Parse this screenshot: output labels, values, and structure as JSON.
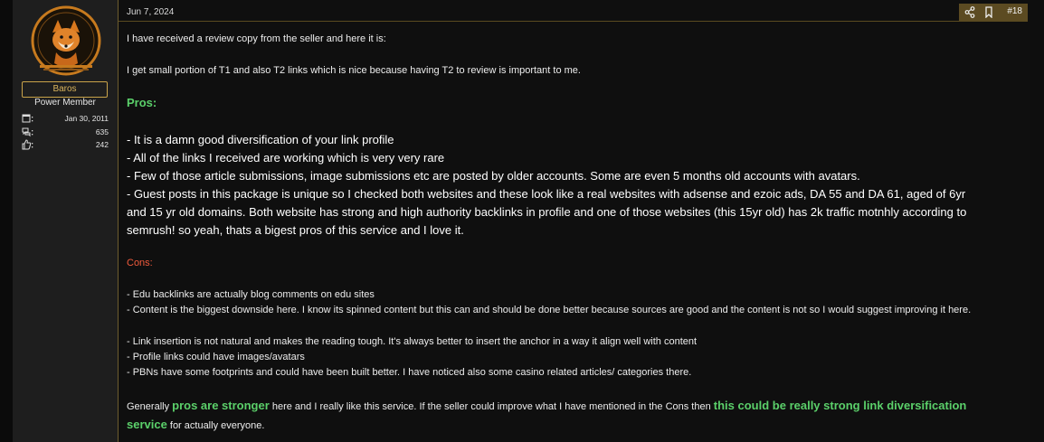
{
  "user": {
    "name": "Baros",
    "title": "Power Member",
    "joined": "Jan 30, 2011",
    "messages": "635",
    "reactions": "242"
  },
  "post": {
    "date": "Jun 7, 2024",
    "number": "#18",
    "p1": "I have received a review copy from the seller and here it is:",
    "p2": "I get small portion of T1 and also T2 links which is nice because having T2 to review is important to me.",
    "pros_heading": "Pros:",
    "pros": [
      "- It is a damn good diversification of your link profile",
      "- All of the links I received are working which is very very rare",
      "- Few of those article submissions, image submissions etc are posted by older accounts. Some are even 5 months old accounts with avatars.",
      "- Guest posts in this package is unique so I checked both websites and these look like a real websites with adsense and ezoic ads, DA 55 and DA 61, aged of 6yr and 15 yr old domains. Both website has strong and high authority backlinks in profile and one of those websites (this 15yr old) has 2k traffic motnhly according to semrush! so yeah, thats a bigest pros of this service and I love it."
    ],
    "cons_heading": "Cons:",
    "cons": [
      "- Edu backlinks are actually blog comments on edu sites",
      "- Content is the biggest downside here. I know its spinned content but this can and should be done better because sources are good and the content is not so I would suggest improving it here.",
      "- Link insertion is not natural and makes the reading tough. It's always better to insert the anchor in a way it align well with content",
      "- Profile links could have images/avatars",
      "- PBNs have some footprints and could have been built better. I have noticed also some casino related articles/ categories there."
    ],
    "summary_a": "Generally ",
    "summary_hl1": "pros are stronger",
    "summary_b": " here and I really like this service. If the seller could improve what I have mentioned in the Cons then ",
    "summary_hl2": "this could be really strong link diversification service",
    "summary_c": " for actually everyone."
  },
  "icons": {
    "share": "share-icon",
    "bookmark": "bookmark-icon",
    "joined": "calendar-icon",
    "messages": "messages-icon",
    "reactions": "thumbs-up-icon"
  },
  "colors": {
    "accent_gold": "#c9a34a",
    "pros_green": "#5bd06a",
    "cons_red": "#f05a3c",
    "action_bar": "#5c4b22"
  }
}
